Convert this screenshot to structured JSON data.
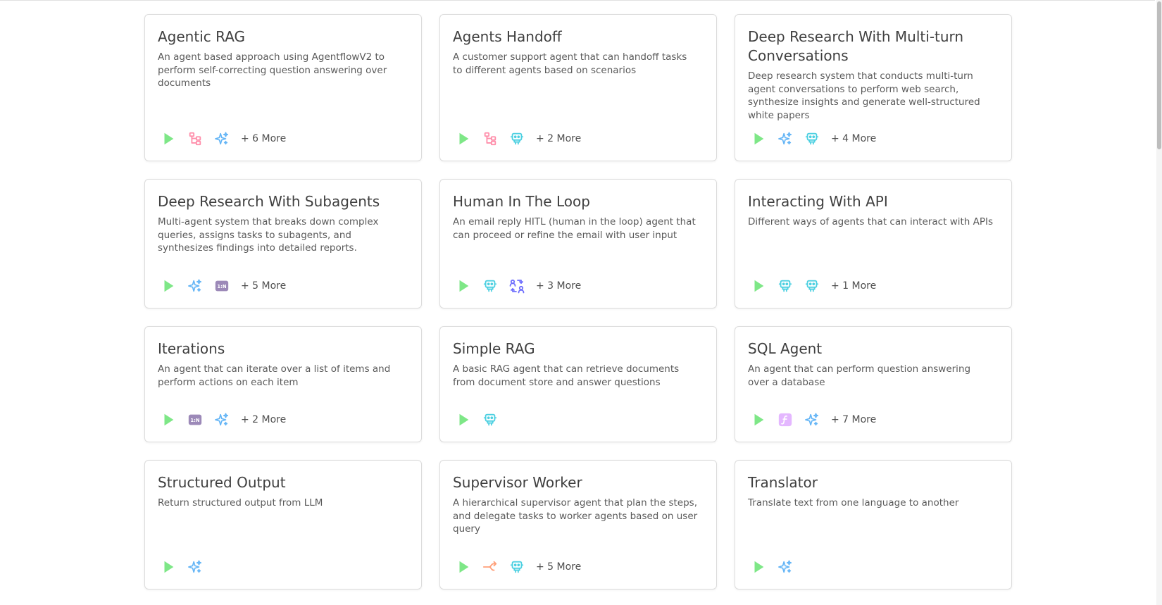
{
  "templates": [
    {
      "title": "Agentic RAG",
      "description": "An agent based approach using AgentflowV2 to perform self-correcting question answering over documents",
      "icons": [
        "start-icon",
        "condition-icon",
        "llm-icon"
      ],
      "more": "+ 6 More"
    },
    {
      "title": "Agents Handoff",
      "description": "A customer support agent that can handoff tasks to different agents based on scenarios",
      "icons": [
        "start-icon",
        "condition-icon",
        "agent-icon"
      ],
      "more": "+ 2 More"
    },
    {
      "title": "Deep Research With Multi-turn Conversations",
      "description": "Deep research system that conducts multi-turn agent conversations to perform web search, synthesize insights and generate well-structured white papers",
      "icons": [
        "start-icon",
        "llm-icon",
        "agent-icon"
      ],
      "more": "+ 4 More"
    },
    {
      "title": "Deep Research With Subagents",
      "description": "Multi-agent system that breaks down complex queries, assigns tasks to subagents, and synthesizes findings into detailed reports.",
      "icons": [
        "start-icon",
        "llm-icon",
        "iteration-icon"
      ],
      "more": "+ 5 More"
    },
    {
      "title": "Human In The Loop",
      "description": "An email reply HITL (human in the loop) agent that can proceed or refine the email with user input",
      "icons": [
        "start-icon",
        "agent-icon",
        "human-input-icon"
      ],
      "more": "+ 3 More"
    },
    {
      "title": "Interacting With API",
      "description": "Different ways of agents that can interact with APIs",
      "icons": [
        "start-icon",
        "agent-icon",
        "agent-icon"
      ],
      "more": "+ 1 More"
    },
    {
      "title": "Iterations",
      "description": "An agent that can iterate over a list of items and perform actions on each item",
      "icons": [
        "start-icon",
        "iteration-icon",
        "llm-icon"
      ],
      "more": "+ 2 More"
    },
    {
      "title": "Simple RAG",
      "description": "A basic RAG agent that can retrieve documents from document store and answer questions",
      "icons": [
        "start-icon",
        "agent-icon"
      ],
      "more": ""
    },
    {
      "title": "SQL Agent",
      "description": "An agent that can perform question answering over a database",
      "icons": [
        "start-icon",
        "custom-function-icon",
        "llm-icon"
      ],
      "more": "+ 7 More"
    },
    {
      "title": "Structured Output",
      "description": "Return structured output from LLM",
      "icons": [
        "start-icon",
        "llm-icon"
      ],
      "more": ""
    },
    {
      "title": "Supervisor Worker",
      "description": "A hierarchical supervisor agent that plan the steps, and delegate tasks to worker agents based on user query",
      "icons": [
        "start-icon",
        "loop-icon",
        "agent-icon"
      ],
      "more": "+ 5 More"
    },
    {
      "title": "Translator",
      "description": "Translate text from one language to another",
      "icons": [
        "start-icon",
        "llm-icon"
      ],
      "more": ""
    }
  ],
  "colors": {
    "start": "#7EE787",
    "condition": "#FF8FAB",
    "llm": "#64B5F6",
    "agent": "#4DD0E1",
    "iteration": "#9C89B8",
    "human_input": "#6E6EFD",
    "custom_function": "#E4B7FF",
    "loop": "#FFA07A"
  }
}
